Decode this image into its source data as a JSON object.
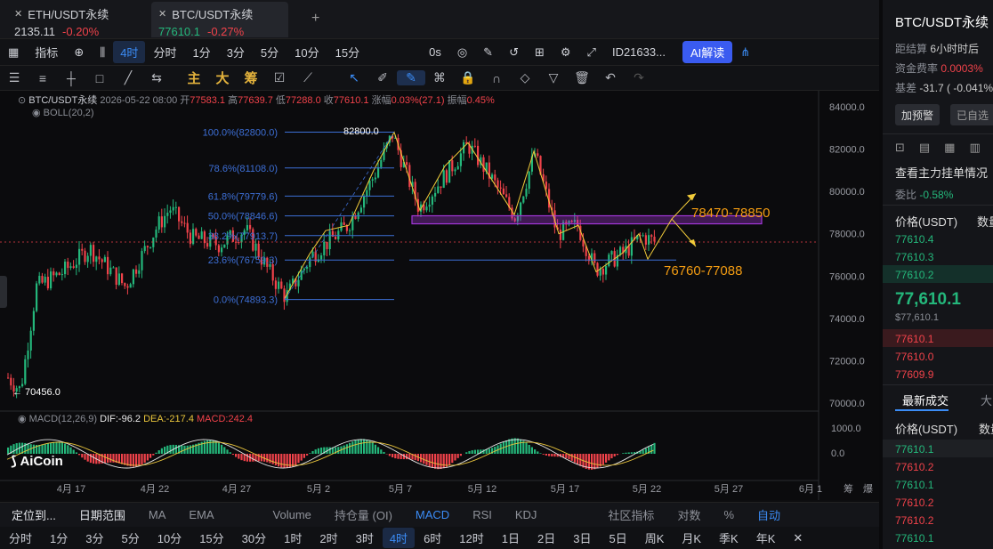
{
  "tabs": [
    {
      "name": "ETH/USDT永续",
      "price": "2135.11",
      "change": "-0.20%",
      "active": false
    },
    {
      "name": "BTC/USDT永续",
      "price": "77610.1",
      "change": "-0.27%",
      "active": true
    }
  ],
  "new_tab": "+",
  "toolbar1": {
    "indicators": "指标",
    "interval_selected": "4时",
    "intervals": [
      "分时",
      "1分",
      "3分",
      "5分",
      "10分",
      "15分"
    ],
    "seconds": "0s",
    "account": "ID21633...",
    "ai": "AI解读"
  },
  "toolbar2": {
    "gold_labels": [
      "主",
      "大",
      "筹"
    ]
  },
  "chart_info": {
    "symbol": "BTC/USDT永续",
    "datetime": "2026-05-22 08:00",
    "open_label": "开",
    "open": "77583.1",
    "high_label": "高",
    "high": "77639.7",
    "low_label": "低",
    "low": "77288.0",
    "close_label": "收",
    "close": "77610.1",
    "chg_label": "涨幅",
    "chg": "0.03%(27.1)",
    "amp_label": "振幅",
    "amp": "0.45%",
    "boll": "BOLL(20,2)"
  },
  "fib": [
    {
      "label": "100.0%(82800.0)",
      "price": 82800
    },
    {
      "label": "78.6%(81108.0)",
      "price": 81108
    },
    {
      "label": "61.8%(79779.6)",
      "price": 79779.6
    },
    {
      "label": "50.0%(78846.6)",
      "price": 78846.6
    },
    {
      "label": "38.2%(77913.7)",
      "price": 77913.7
    },
    {
      "label": "23.6%(76759.3)",
      "price": 76759.3
    },
    {
      "label": "0.0%(74893.3)",
      "price": 74893.3
    }
  ],
  "annotations": {
    "high": "82800.0",
    "low": "← 70456.0",
    "resist": "78470-78850",
    "support": "76760-77088"
  },
  "price_axis": [
    "84000.0",
    "82000.0",
    "80000.0",
    "78000.0",
    "76000.0",
    "74000.0",
    "72000.0",
    "70000.0"
  ],
  "macd_axis": [
    "1000.0",
    "0.0"
  ],
  "date_axis": [
    "4月 17",
    "4月 22",
    "4月 27",
    "5月 2",
    "5月 7",
    "5月 12",
    "5月 17",
    "5月 22",
    "5月 27",
    "6月 1"
  ],
  "date_axis_right": [
    "筹",
    "爆"
  ],
  "macd_info": {
    "name": "MACD(12,26,9)",
    "dif": "DIF:-96.2",
    "dea": "DEA:-217.4",
    "macd": "MACD:242.4"
  },
  "logo": "AiCoin",
  "bottom_tabs": {
    "locate": "定位到...",
    "range": "日期范围",
    "items": [
      "MA",
      "EMA",
      "Volume",
      "持仓量 (OI)",
      "MACD",
      "RSI",
      "KDJ"
    ],
    "community": "社区指标",
    "log": "对数",
    "pct": "%",
    "auto": "自动"
  },
  "timeframes": [
    "分时",
    "1分",
    "3分",
    "5分",
    "10分",
    "15分",
    "30分",
    "1时",
    "2时",
    "3时",
    "4时",
    "6时",
    "12时",
    "1日",
    "2日",
    "3日",
    "5日",
    "周K",
    "月K",
    "季K",
    "年K"
  ],
  "selected_timeframe": "4时",
  "sidebar": {
    "title": "BTC/USDT永续",
    "settle_label": "距结算",
    "settle": "6小时时后",
    "funding_label": "资金费率",
    "funding": "0.0003%",
    "basis_label": "基差",
    "basis": "-31.7 ( -0.041%",
    "alert_btn": "加预警",
    "fav_btn": "已自选",
    "orders_title": "查看主力挂单情况",
    "ratio_label": "委比",
    "ratio": "-0.58%",
    "price_header": "价格(USDT)",
    "qty_header": "数量",
    "asks": [
      "77610.4",
      "77610.3",
      "77610.2"
    ],
    "last": "77,610.1",
    "last_usd": "$77,610.1",
    "bids": [
      "77610.1",
      "77610.0",
      "77609.9"
    ],
    "trades_tab": "最新成交",
    "big_tab": "大",
    "trades": [
      {
        "p": "77610.1",
        "side": "buy"
      },
      {
        "p": "77610.2",
        "side": "sell"
      },
      {
        "p": "77610.1",
        "side": "buy"
      },
      {
        "p": "77610.2",
        "side": "sell"
      },
      {
        "p": "77610.2",
        "side": "sell"
      },
      {
        "p": "77610.1",
        "side": "buy"
      }
    ]
  },
  "colors": {
    "up": "#24b77b",
    "down": "#f0424a",
    "accent": "#3b8cf6",
    "fib": "#3d6fd6",
    "zone": "#a237d8",
    "anno": "#f39c12"
  }
}
